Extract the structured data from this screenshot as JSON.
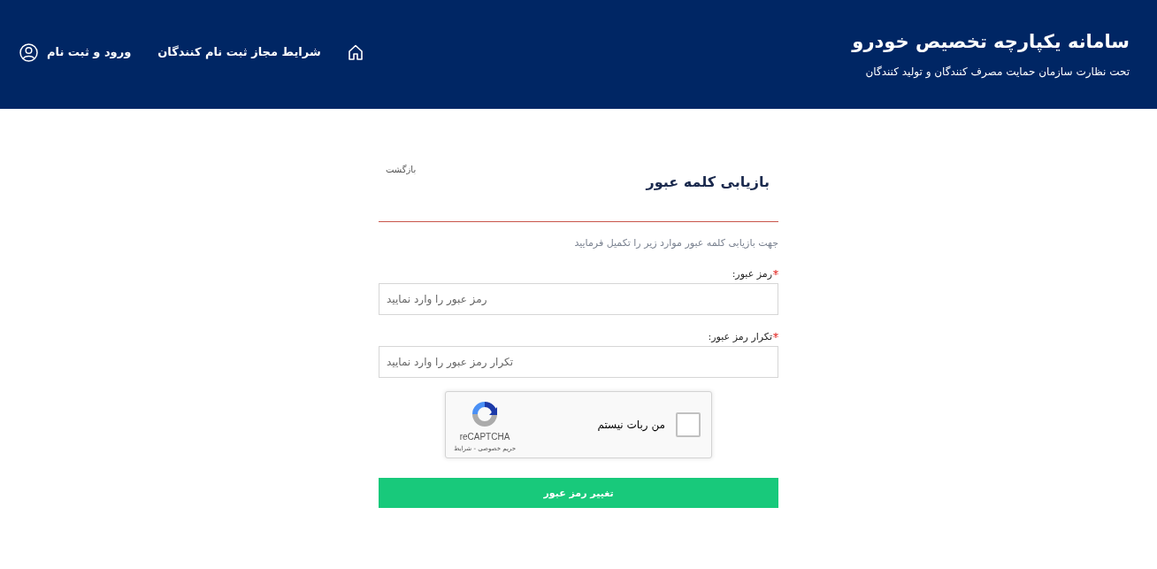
{
  "header": {
    "title": "سامانه یکپارچه تخصیص خودرو",
    "subtitle": "تحت نظارت سازمان حمایت مصرف کنندگان و تولید کنندگان",
    "nav": [
      {
        "kind": "home"
      },
      {
        "kind": "link",
        "label": "شرایط مجاز ثبت نام کنندگان"
      },
      {
        "kind": "account",
        "label": "ورود و ثبت نام"
      }
    ]
  },
  "form": {
    "back_link": "بازگشت",
    "title": "بازیابی کلمه عبور",
    "instruction": "جهت بازیابی کلمه عبور موارد زیر را تکمیل فرمایید",
    "fields": [
      {
        "label": "رمز عبور:",
        "required": true,
        "placeholder": "رمز عبور را وارد نمایید"
      },
      {
        "label": "تکرار رمز عبور:",
        "required": true,
        "placeholder": "تکرار رمز عبور را وارد نمایید"
      }
    ],
    "captcha": {
      "checked": false,
      "label": "من ربات نیستم",
      "brand": "reCAPTCHA",
      "links": "حریم خصوصی - شرایط"
    },
    "submit": "تغییر رمز عبور"
  }
}
